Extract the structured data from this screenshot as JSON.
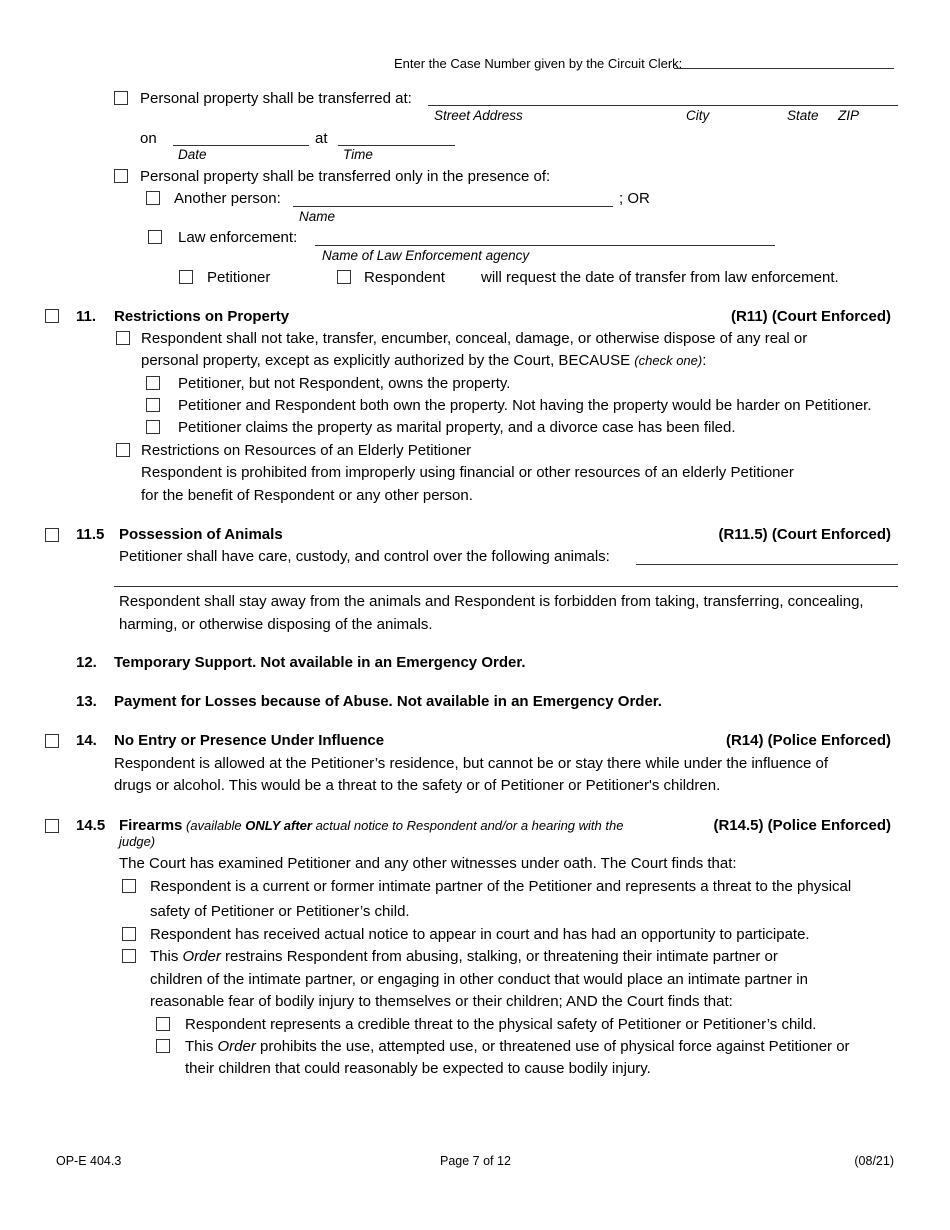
{
  "header": {
    "case_number_label": "Enter the Case Number given by the Circuit Clerk:",
    "case_number_value": ""
  },
  "transfer": {
    "at_label": "Personal property shall be transferred at:",
    "address_labels": {
      "street": "Street Address",
      "city": "City",
      "state": "State",
      "zip": "ZIP"
    },
    "on_label": "on",
    "at2_label": "at",
    "date_label": "Date",
    "time_label": "Time",
    "presence_label": "Personal property shall be transferred only in the presence of:",
    "another_person_label": "Another person:",
    "or_label": "; OR",
    "name_label": "Name",
    "law_enforcement_label": "Law enforcement:",
    "agency_label": "Name of Law Enforcement agency",
    "petitioner_label": "Petitioner",
    "respondent_label": "Respondent",
    "request_text": "will request the date of transfer from law enforcement."
  },
  "s11": {
    "number": "11.",
    "title": "Restrictions on Property",
    "code": "(R11) (Court Enforced)",
    "main_line1": "Respondent shall not take, transfer, encumber, conceal, damage, or otherwise dispose of any real or",
    "main_line2": "personal property, except as explicitly authorized by the Court, BECAUSE ",
    "check_one": "(check one)",
    "colon": ":",
    "opt1": "Petitioner, but not Respondent, owns the property.",
    "opt2": "Petitioner and Respondent both own the property. Not having the property would be harder on Petitioner.",
    "opt3": "Petitioner claims the property as marital property, and a divorce case has been filed.",
    "elderly_title": "Restrictions on Resources of an Elderly Petitioner",
    "elderly_line1": "Respondent is prohibited from improperly using financial or other resources of an elderly Petitioner",
    "elderly_line2": "for the benefit of Respondent or any other person."
  },
  "s115": {
    "number": "11.5",
    "title": "Possession of Animals",
    "code": "(R11.5) (Court Enforced)",
    "custody_text": "Petitioner shall have care, custody, and control over the following animals:",
    "stay_line1": "Respondent shall stay away from the animals and Respondent is forbidden from taking, transferring, concealing,",
    "stay_line2": "harming, or otherwise disposing of the animals."
  },
  "s12": {
    "number": "12.",
    "text": "Temporary Support. Not available in an Emergency Order."
  },
  "s13": {
    "number": "13.",
    "text": "Payment for Losses because of Abuse. Not available in an Emergency Order."
  },
  "s14": {
    "number": "14.",
    "title": "No Entry or Presence Under Influence",
    "code": "(R14) (Police Enforced)",
    "line1": "Respondent is allowed at the Petitioner’s residence, but cannot be or stay there while under the influence of",
    "line2": "drugs or alcohol. This would be a threat to the safety or of Petitioner or Petitioner's children."
  },
  "s145": {
    "number": "14.5",
    "title": "Firearms",
    "note_a": " (available ",
    "note_b": "ONLY after",
    "note_c": " actual notice to Respondent and/or a hearing with the",
    "note_d": "judge)",
    "code": "(R14.5) (Police Enforced)",
    "intro": "The Court has examined Petitioner and any other witnesses under oath. The Court finds that:",
    "f1_line1": "Respondent is a current or former intimate partner of the Petitioner and represents a threat to the physical",
    "f1_line2": "safety of Petitioner or Petitioner’s child.",
    "f2": "Respondent has received actual notice to appear in court and has had an opportunity to participate.",
    "f3_a": "This ",
    "f3_order": "Order",
    "f3_b": " restrains Respondent from abusing, stalking, or threatening their intimate partner or",
    "f3_line2": "children of the intimate partner, or engaging in other conduct that would place an intimate partner in",
    "f3_line3": "reasonable fear of bodily injury to themselves or their children; AND the Court finds that:",
    "g1": "Respondent represents a credible threat to the physical safety of Petitioner or Petitioner’s child.",
    "g2_a": "This ",
    "g2_order": "Order",
    "g2_b": " prohibits the use, attempted use, or threatened use of physical force against Petitioner or",
    "g2_line2": "their children that could reasonably be expected to cause bodily injury."
  },
  "footer": {
    "form_id": "OP-E 404.3",
    "page": "Page 7 of 12",
    "revision": "(08/21)"
  }
}
